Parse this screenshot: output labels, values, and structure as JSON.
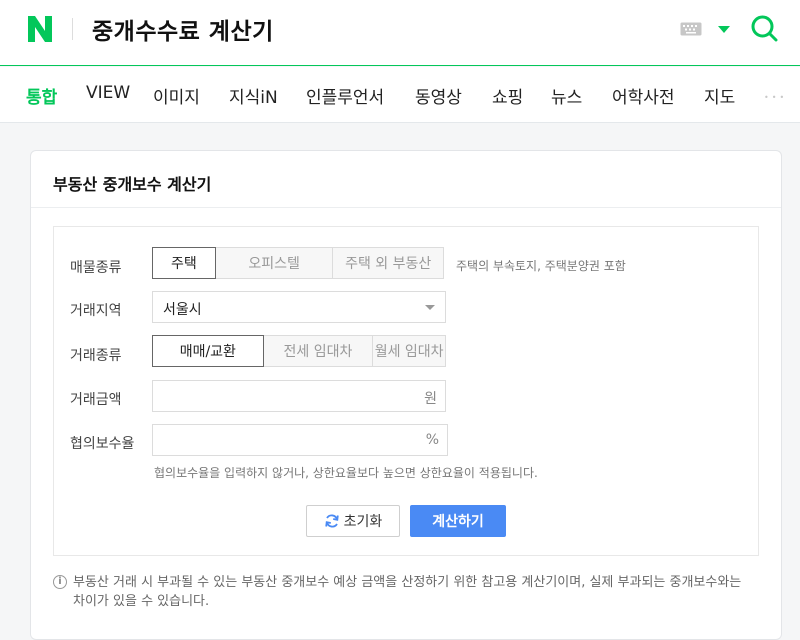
{
  "header": {
    "logo_letter": "N",
    "query": "중개수수료 계산기"
  },
  "tabs": [
    {
      "label": "통합",
      "active": true
    },
    {
      "label": "VIEW"
    },
    {
      "label": "이미지"
    },
    {
      "label": "지식iN"
    },
    {
      "label": "인플루언서"
    },
    {
      "label": "동영상"
    },
    {
      "label": "쇼핑"
    },
    {
      "label": "뉴스"
    },
    {
      "label": "어학사전"
    },
    {
      "label": "지도"
    }
  ],
  "more": "•••",
  "calculator": {
    "title": "부동산 중개보수 계산기",
    "property_type": {
      "label": "매물종류",
      "options": [
        "주택",
        "오피스텔",
        "주택 외 부동산"
      ],
      "selected": "주택",
      "note": "주택의 부속토지, 주택분양권 포함"
    },
    "region": {
      "label": "거래지역",
      "value": "서울시"
    },
    "trade_type": {
      "label": "거래종류",
      "options": [
        "매매/교환",
        "전세 임대차",
        "월세 임대차"
      ],
      "selected": "매매/교환"
    },
    "amount": {
      "label": "거래금액",
      "unit": "원",
      "value": ""
    },
    "rate": {
      "label": "협의보수율",
      "unit": "%",
      "value": "",
      "note": "협의보수율을 입력하지 않거나, 상한요율보다 높으면 상한요율이 적용됩니다."
    },
    "reset_label": "초기화",
    "calc_label": "계산하기",
    "disclaimer": "부동산 거래 시 부과될 수 있는 부동산 중개보수 예상 금액을 산정하기 위한 참고용 계산기이며, 실제 부과되는 중개보수와는 차이가 있을 수 있습니다.",
    "info_symbol": "i"
  },
  "colors": {
    "brand_green": "#03c75a",
    "calc_button": "#4a8af4"
  }
}
